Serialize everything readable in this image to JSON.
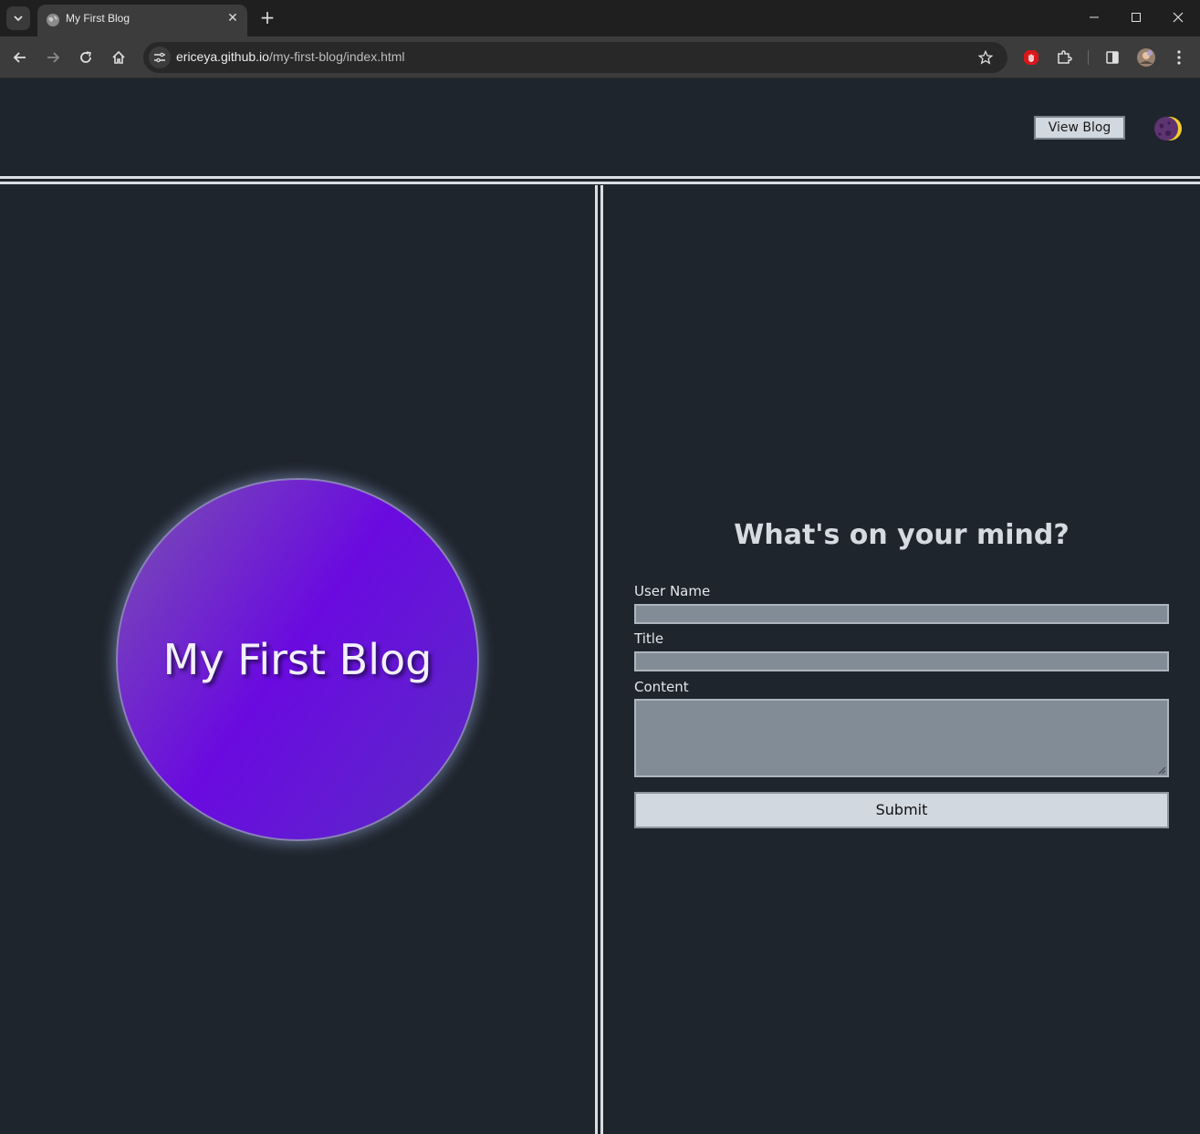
{
  "browser": {
    "tab_title": "My First Blog",
    "url_host": "ericeya.github.io",
    "url_path": "/my-first-blog/index.html"
  },
  "header": {
    "view_blog_label": "View Blog",
    "theme_icon": "moon-icon"
  },
  "hero": {
    "title": "My First Blog"
  },
  "form": {
    "heading": "What's on your mind?",
    "username_label": "User Name",
    "username_value": "",
    "title_label": "Title",
    "title_value": "",
    "content_label": "Content",
    "content_value": "",
    "submit_label": "Submit"
  },
  "colors": {
    "page_bg": "#1f252d",
    "accent_purple": "#6a0ae0",
    "divider": "#d8dde3",
    "input_bg": "#818c97"
  }
}
